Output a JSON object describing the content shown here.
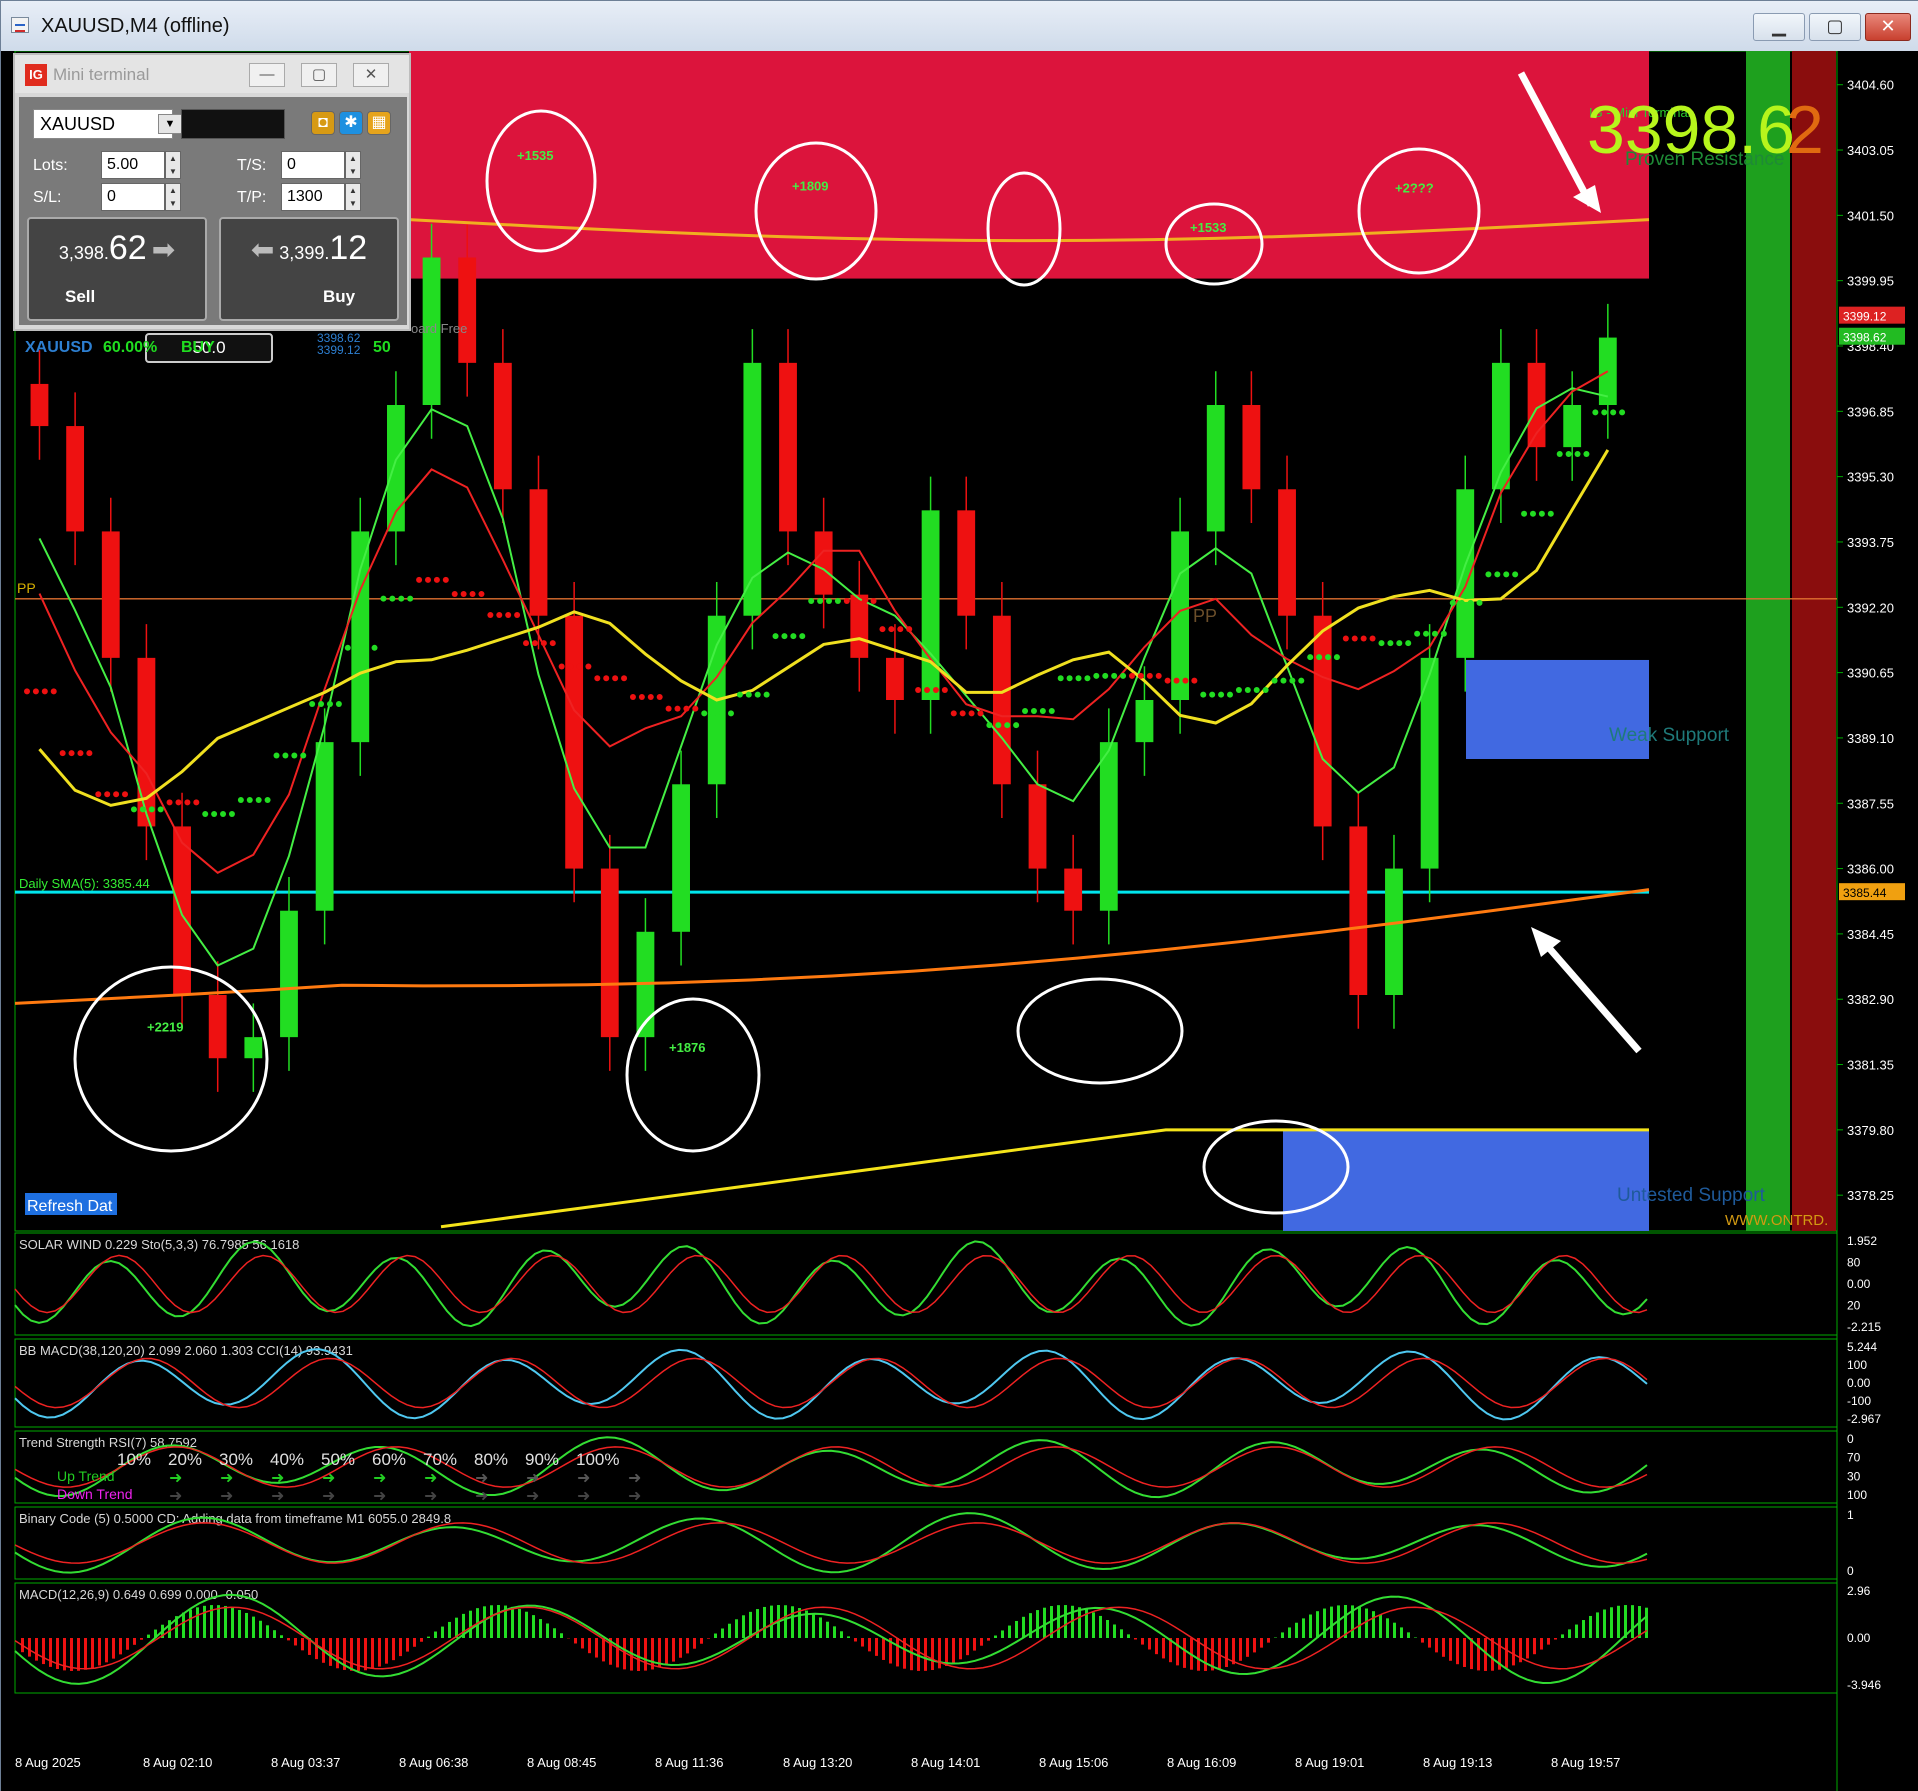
{
  "window": {
    "title": "XAUUSD,M4 (offline)",
    "buttons": {
      "minimize": "▁",
      "maximize": "▢",
      "close": "✕"
    }
  },
  "mini_terminal": {
    "title": "Mini terminal",
    "logo": "IG",
    "symbol": "XAUUSD",
    "lots_label": "Lots:",
    "lots_value": "5.00",
    "ts_label": "T/S:",
    "ts_value": "0",
    "sl_label": "S/L:",
    "sl_value": "0",
    "tp_label": "T/P:",
    "tp_value": "1300",
    "sell_price_small": "3,398.",
    "sell_price_big": "62",
    "buy_price_small": "3,399.",
    "buy_price_big": "12",
    "sell_label": "Sell",
    "buy_label": "Buy",
    "lot_amount": "50.0",
    "below": {
      "symbol": "XAUUSD",
      "percent": "60.00%",
      "direction": "BUY",
      "bid": "3398.62",
      "ask": "3399.12",
      "count": "50",
      "board": "oard Free"
    }
  },
  "overlays": {
    "big_price_green": "3398.6",
    "big_price_orange": "2",
    "ig_label": "IG - Mini Terminal",
    "proven_resistance": "Proven Resistance",
    "weak_support": "Weak Support",
    "untested_support": "Untested Support",
    "www": "WWW.ONTRD.",
    "daily_sma": "Daily SMA(5): 3385.44",
    "pp": "PP",
    "pp2": "PP",
    "refresh": "Refresh Dat",
    "annotations": [
      "+1535",
      "+1809",
      "+1533",
      "+2???",
      "+2219",
      "+1876"
    ]
  },
  "chart_data": [
    {
      "type": "line",
      "title": "XAUUSD,M4",
      "y_axis_ticks": [
        3404.6,
        3403.05,
        3401.5,
        3399.95,
        3398.4,
        3396.85,
        3395.3,
        3393.75,
        3392.2,
        3390.65,
        3389.1,
        3387.55,
        3386.0,
        3384.45,
        3382.9,
        3381.35,
        3379.8,
        3378.25
      ],
      "ylim": [
        3377.4,
        3405.4
      ],
      "price_labels": {
        "ask": "3399.12",
        "bid": "3398.62",
        "daily_sma": "3385.44"
      },
      "x_tick_labels": [
        "8 Aug 2025",
        "8 Aug 02:10",
        "8 Aug 03:37",
        "8 Aug 06:38",
        "8 Aug 08:45",
        "8 Aug 11:36",
        "8 Aug 13:20",
        "8 Aug 14:01",
        "8 Aug 15:06",
        "8 Aug 16:09",
        "8 Aug 19:01",
        "8 Aug 19:13",
        "8 Aug 19:57"
      ],
      "series": [
        {
          "name": "Close",
          "values": [
            3396.5,
            3394.0,
            3391.0,
            3387.0,
            3383.0,
            3381.5,
            3382.0,
            3385.0,
            3389.0,
            3394.0,
            3397.0,
            3400.5,
            3398.0,
            3395.0,
            3392.0,
            3386.0,
            3382.0,
            3384.5,
            3388.0,
            3392.0,
            3398.0,
            3394.0,
            3392.5,
            3391.0,
            3390.0,
            3394.5,
            3392.0,
            3388.0,
            3386.0,
            3385.0,
            3389.0,
            3390.0,
            3394.0,
            3397.0,
            3395.0,
            3392.0,
            3387.0,
            3383.0,
            3386.0,
            3391.0,
            3395.0,
            3398.0,
            3396.0,
            3397.0,
            3398.6
          ]
        }
      ]
    },
    {
      "type": "line",
      "title": "SOLAR WIND 0.229  Sto(5,3,3) 76.7985 56.1618",
      "y_axis_ticks": [
        "1.952",
        "80",
        "0.00",
        "20",
        "-2.215"
      ]
    },
    {
      "type": "line",
      "title": "BB MACD(38,120,20) 2.099 2.060 1.303  CCI(14) 93.9431",
      "y_axis_ticks": [
        "5.244",
        "100",
        "0.00",
        "-100",
        "-2.967"
      ]
    },
    {
      "type": "line",
      "title": "Trend Strength   RSI(7) 58.7592",
      "y_axis_ticks": [
        "0",
        "70",
        "30",
        "100"
      ],
      "strength_labels": [
        "10%",
        "20%",
        "30%",
        "40%",
        "50%",
        "60%",
        "70%",
        "80%",
        "90%",
        "100%"
      ],
      "up_label": "Up Trend",
      "down_label": "Down Trend"
    },
    {
      "type": "line",
      "title": "Binary Code (5) 0.5000   CD: Adding data from timeframe M1  6055.0 2849.8",
      "y_axis_ticks": [
        "1",
        "0"
      ]
    },
    {
      "type": "bar",
      "title": "MACD(12,26,9) 0.649 0.699 0.000 -0.050",
      "y_axis_ticks": [
        "2.96",
        "0.00",
        "-3.946"
      ]
    }
  ],
  "colors": {
    "background": "#000000",
    "bull": "#22dd22",
    "bear": "#ee1111",
    "resistance_zone": "#dc143c",
    "support_zone": "#4169e1",
    "sma_line": "#00e5ee",
    "grid_border": "#00aa00"
  }
}
